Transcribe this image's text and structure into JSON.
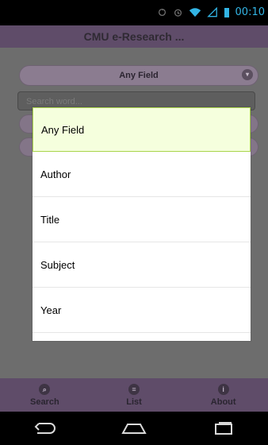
{
  "status": {
    "time": "00:10",
    "icons": [
      "sync-icon",
      "alarm-icon",
      "wifi-icon",
      "signal-icon",
      "battery-icon"
    ]
  },
  "app": {
    "title": "CMU e-Research ..."
  },
  "search": {
    "field_selector_value": "Any Field",
    "placeholder": "Search word..."
  },
  "popup": {
    "items": [
      {
        "label": "Any Field",
        "selected": true
      },
      {
        "label": "Author",
        "selected": false
      },
      {
        "label": "Title",
        "selected": false
      },
      {
        "label": "Subject",
        "selected": false
      },
      {
        "label": "Year",
        "selected": false
      }
    ]
  },
  "bottom_nav": [
    {
      "label": "Search",
      "icon": "search-icon"
    },
    {
      "label": "List",
      "icon": "list-icon"
    },
    {
      "label": "About",
      "icon": "info-icon"
    }
  ]
}
